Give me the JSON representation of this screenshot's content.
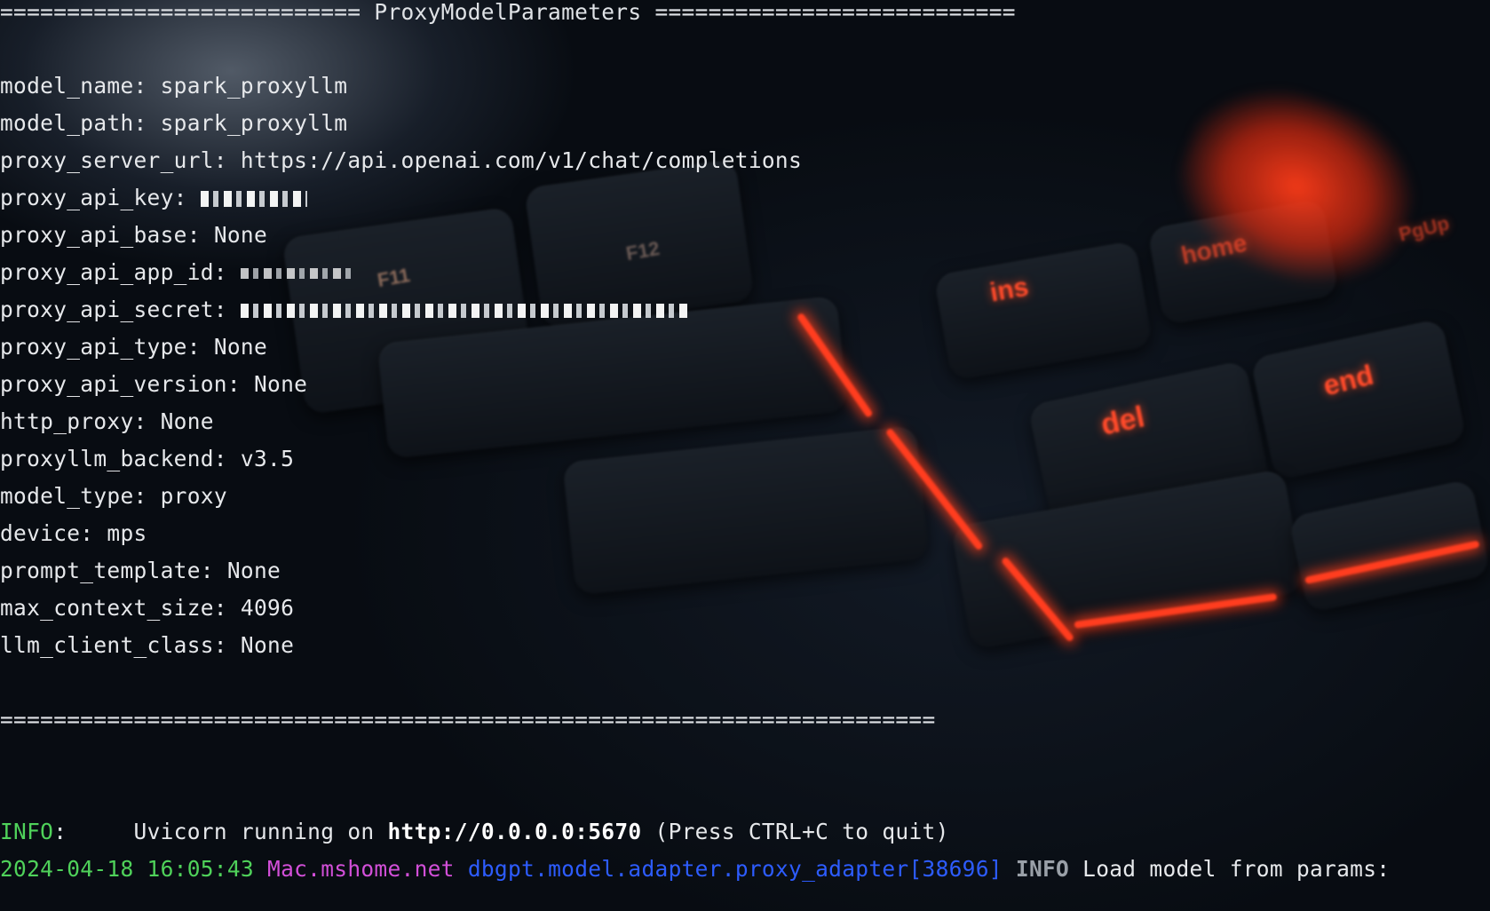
{
  "terminal": {
    "header": "=========================== ProxyModelParameters ===========================",
    "params": [
      {
        "key": "model_name:",
        "value": "spark_proxyllm"
      },
      {
        "key": "model_path:",
        "value": "spark_proxyllm"
      },
      {
        "key": "proxy_server_url:",
        "value": "https://api.openai.com/v1/chat/completions"
      },
      {
        "key": "proxy_api_key:",
        "value": ""
      },
      {
        "key": "proxy_api_base:",
        "value": "None"
      },
      {
        "key": "proxy_api_app_id:",
        "value": ""
      },
      {
        "key": "proxy_api_secret:",
        "value": ""
      },
      {
        "key": "proxy_api_type:",
        "value": "None"
      },
      {
        "key": "proxy_api_version:",
        "value": "None"
      },
      {
        "key": "http_proxy:",
        "value": "None"
      },
      {
        "key": "proxyllm_backend:",
        "value": "v3.5"
      },
      {
        "key": "model_type:",
        "value": "proxy"
      },
      {
        "key": "device:",
        "value": "mps"
      },
      {
        "key": "prompt_template:",
        "value": "None"
      },
      {
        "key": "max_context_size:",
        "value": "4096"
      },
      {
        "key": "llm_client_class:",
        "value": "None"
      }
    ],
    "footer": "======================================================================",
    "uvicorn": {
      "level": "INFO",
      "colon": ":",
      "text": "Uvicorn running on",
      "url": "http://0.0.0.0:5670",
      "hint": "(Press CTRL+C to quit)"
    },
    "log": {
      "timestamp": "2024-04-18 16:05:43",
      "host": "Mac.mshome.net",
      "logger": "dbgpt.model.adapter.proxy_adapter[38696]",
      "level": "INFO",
      "message": "Load model from params:"
    }
  },
  "background": {
    "key_labels": [
      "F11",
      "F12",
      "ins",
      "home",
      "del",
      "end",
      "PgUp"
    ],
    "accent_color": "#ff3d1f"
  }
}
